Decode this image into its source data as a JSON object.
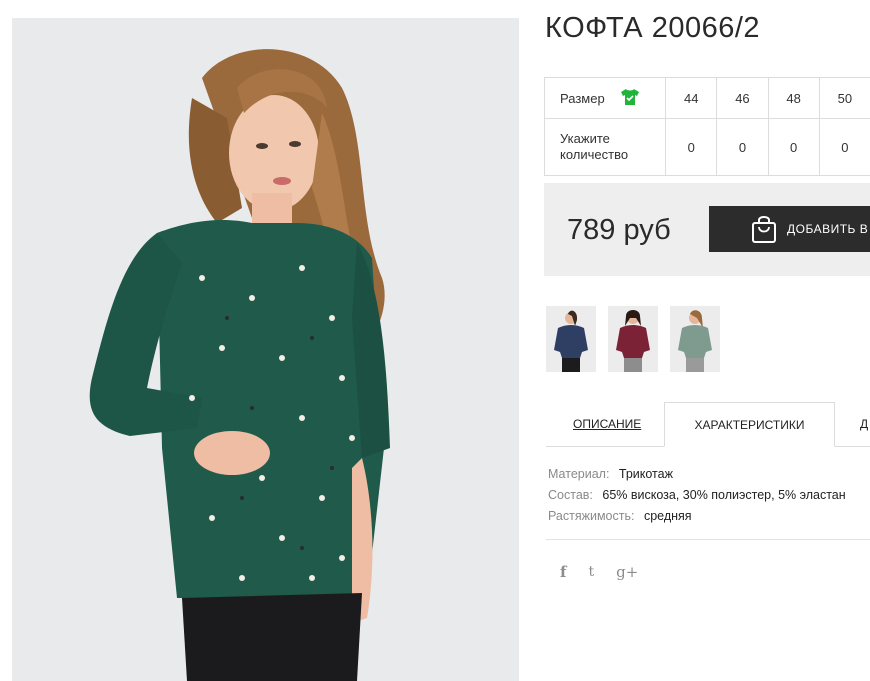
{
  "product": {
    "title": "КОФТА 20066/2",
    "price": "789 руб",
    "add_to_cart_label": "ДОБАВИТЬ В"
  },
  "size_table": {
    "size_label": "Размер",
    "qty_label_line1": "Укажите",
    "qty_label_line2": "количество",
    "sizes": [
      "44",
      "46",
      "48",
      "50"
    ],
    "quantities": [
      "0",
      "0",
      "0",
      "0"
    ]
  },
  "tabs": {
    "description": "ОПИСАНИЕ",
    "characteristics": "ХАРАКТЕРИСТИКИ",
    "next": "Д"
  },
  "specs": [
    {
      "key": "Материал:",
      "value": "Трикотаж"
    },
    {
      "key": "Состав:",
      "value": "65% вискоза, 30% полиэстер, 5% эластан"
    },
    {
      "key": "Растяжимость:",
      "value": "средняя"
    }
  ],
  "thumbnails": [
    {
      "color": "#2f3f63"
    },
    {
      "color": "#7c2236"
    },
    {
      "color": "#7f9a8e"
    }
  ],
  "colors": {
    "sweater": "#1f5a4b",
    "accent_green": "#21b33a",
    "button_bg": "#2c2c2c",
    "price_bg": "#eeeeee"
  },
  "social": {
    "facebook": "f",
    "twitter": "t",
    "google_plus": "g+"
  }
}
